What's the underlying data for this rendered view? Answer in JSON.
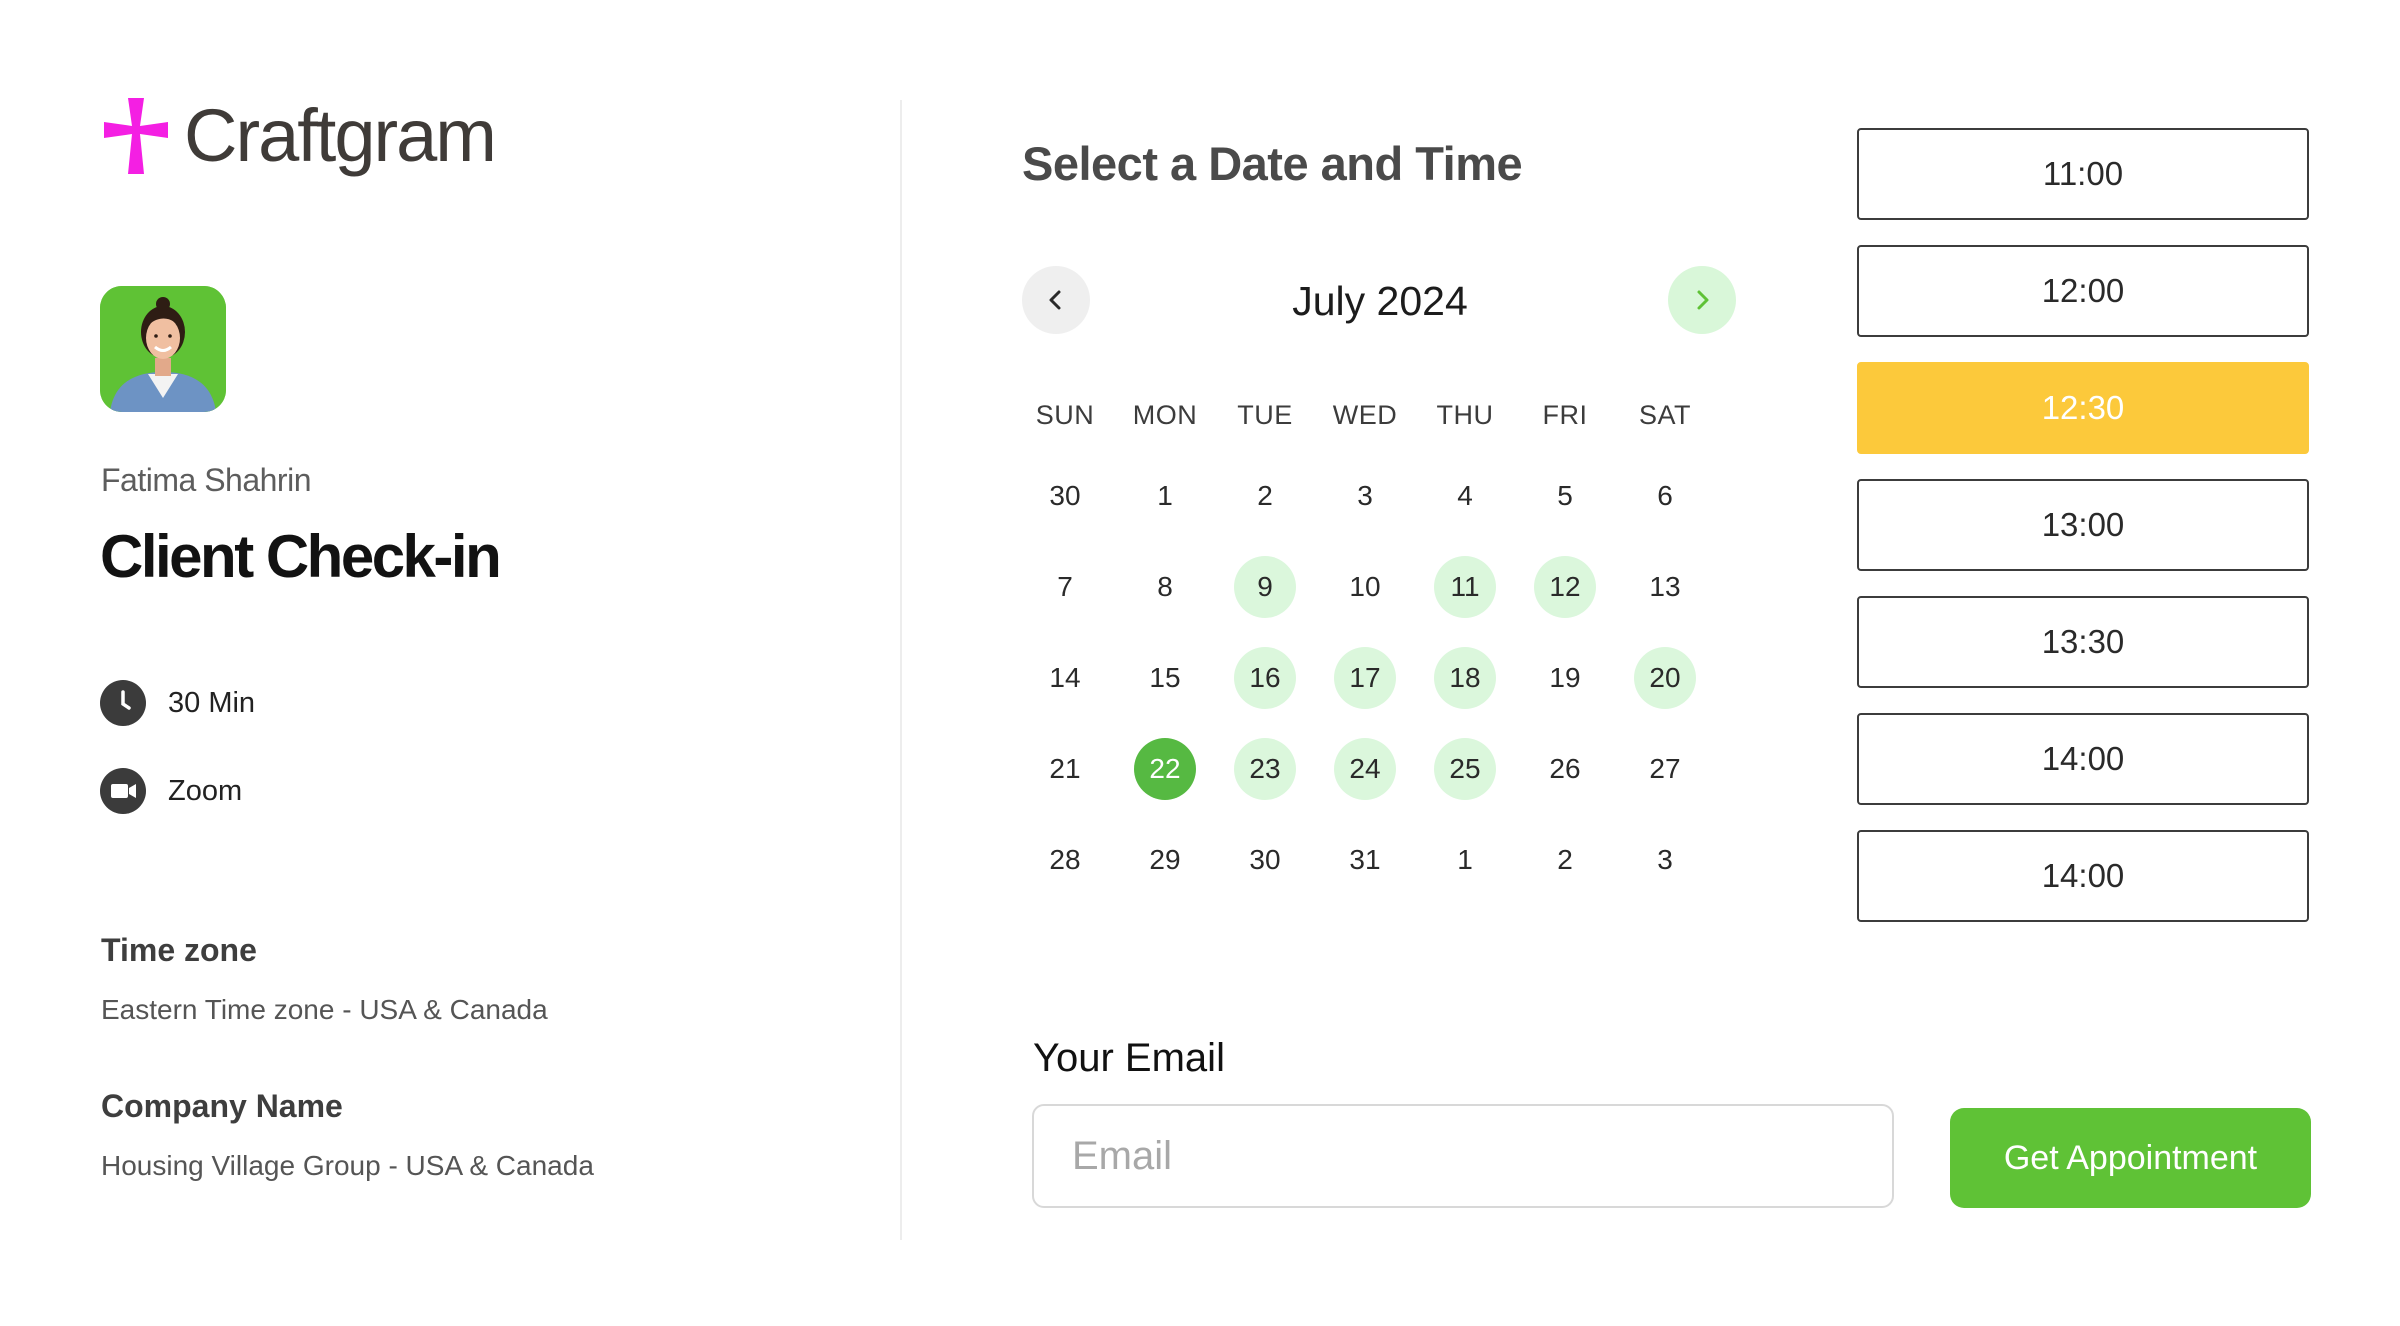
{
  "brand": {
    "name": "Craftgram",
    "logo_color": "#f41fe3"
  },
  "host": {
    "name": "Fatima Shahrin",
    "avatar_bg": "#5fc235"
  },
  "event": {
    "title": "Client Check-in",
    "duration": "30 Min",
    "duration_icon": "clock-icon",
    "platform": "Zoom",
    "platform_icon": "video-camera-icon"
  },
  "timezone": {
    "label": "Time zone",
    "value": "Eastern Time zone - USA & Canada"
  },
  "company": {
    "label": "Company Name",
    "value": "Housing Village Group - USA & Canada"
  },
  "calendar": {
    "heading": "Select a Date and Time",
    "month": "July 2024",
    "prev_icon": "chevron-left-icon",
    "next_icon": "chevron-right-icon",
    "weekdays": [
      "SUN",
      "MON",
      "TUE",
      "WED",
      "THU",
      "FRI",
      "SAT"
    ],
    "weeks": [
      [
        {
          "d": "30",
          "s": ""
        },
        {
          "d": "1",
          "s": ""
        },
        {
          "d": "2",
          "s": ""
        },
        {
          "d": "3",
          "s": ""
        },
        {
          "d": "4",
          "s": ""
        },
        {
          "d": "5",
          "s": ""
        },
        {
          "d": "6",
          "s": ""
        }
      ],
      [
        {
          "d": "7",
          "s": ""
        },
        {
          "d": "8",
          "s": ""
        },
        {
          "d": "9",
          "s": "available"
        },
        {
          "d": "10",
          "s": ""
        },
        {
          "d": "11",
          "s": "available"
        },
        {
          "d": "12",
          "s": "available"
        },
        {
          "d": "13",
          "s": ""
        }
      ],
      [
        {
          "d": "14",
          "s": ""
        },
        {
          "d": "15",
          "s": ""
        },
        {
          "d": "16",
          "s": "available"
        },
        {
          "d": "17",
          "s": "available"
        },
        {
          "d": "18",
          "s": "available"
        },
        {
          "d": "19",
          "s": ""
        },
        {
          "d": "20",
          "s": "available"
        }
      ],
      [
        {
          "d": "21",
          "s": ""
        },
        {
          "d": "22",
          "s": "selected"
        },
        {
          "d": "23",
          "s": "available"
        },
        {
          "d": "24",
          "s": "available"
        },
        {
          "d": "25",
          "s": "available"
        },
        {
          "d": "26",
          "s": ""
        },
        {
          "d": "27",
          "s": ""
        }
      ],
      [
        {
          "d": "28",
          "s": ""
        },
        {
          "d": "29",
          "s": ""
        },
        {
          "d": "30",
          "s": ""
        },
        {
          "d": "31",
          "s": ""
        },
        {
          "d": "1",
          "s": ""
        },
        {
          "d": "2",
          "s": ""
        },
        {
          "d": "3",
          "s": ""
        }
      ]
    ],
    "available_color": "#dbf7dc",
    "selected_color": "#56b942"
  },
  "times": [
    {
      "label": "11:00",
      "active": false
    },
    {
      "label": "12:00",
      "active": false
    },
    {
      "label": "12:30",
      "active": true
    },
    {
      "label": "13:00",
      "active": false
    },
    {
      "label": "13:30",
      "active": false
    },
    {
      "label": "14:00",
      "active": false
    },
    {
      "label": "14:00",
      "active": false
    }
  ],
  "times_active_color": "#fcc93b",
  "email": {
    "label": "Your Email",
    "placeholder": "Email",
    "value": ""
  },
  "cta": {
    "label": "Get Appointment",
    "color": "#5fc236"
  }
}
